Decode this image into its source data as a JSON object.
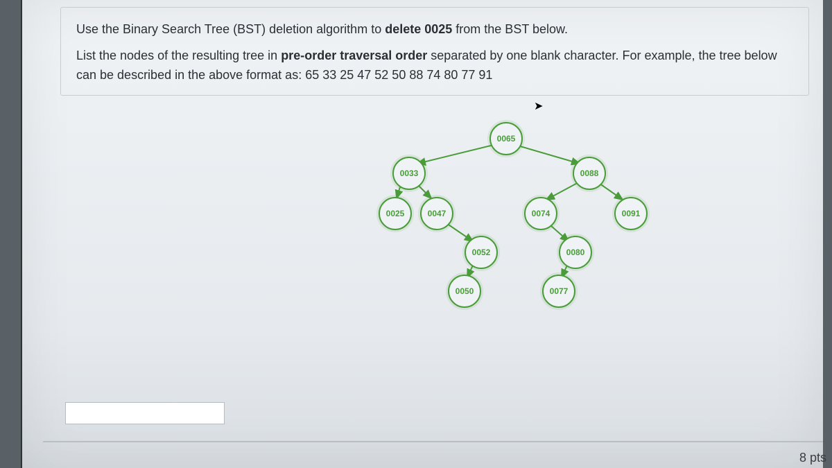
{
  "question": {
    "line1_pre": "Use the Binary Search Tree (BST) deletion algorithm  to ",
    "line1_bold": "delete 0025",
    "line1_post": " from the BST below.",
    "line2_pre": "List the nodes of the resulting tree in ",
    "line2_bold": "pre-order traversal order",
    "line2_post": " separated by one blank character. For example, the tree below can be described in the above format as:  65 33 25 47 52 50 88 74 80 77 91"
  },
  "nodes": {
    "n65": "0065",
    "n33": "0033",
    "n88": "0088",
    "n25": "0025",
    "n47": "0047",
    "n74": "0074",
    "n91": "0091",
    "n52": "0052",
    "n80": "0080",
    "n50": "0050",
    "n77": "0077"
  },
  "answer_value": "",
  "points_label": "8 pts"
}
